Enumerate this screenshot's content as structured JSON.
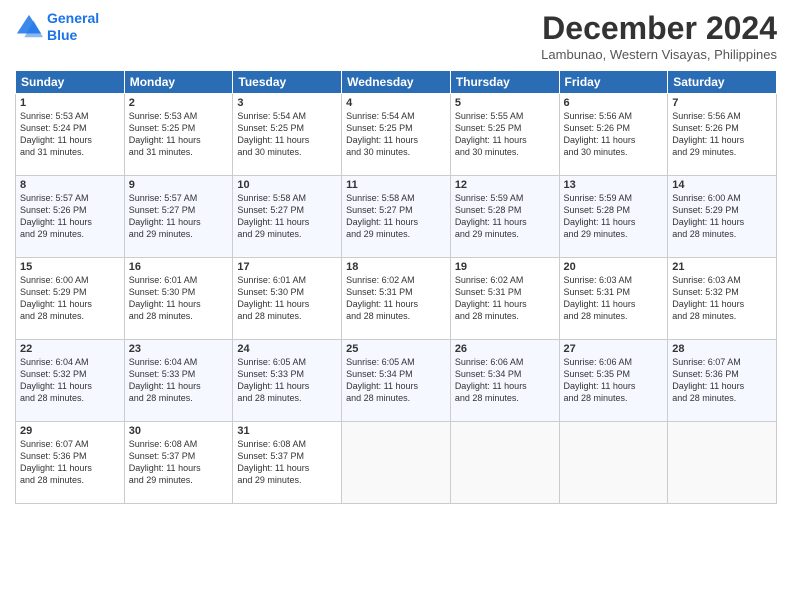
{
  "logo": {
    "line1": "General",
    "line2": "Blue"
  },
  "title": "December 2024",
  "location": "Lambunao, Western Visayas, Philippines",
  "days_header": [
    "Sunday",
    "Monday",
    "Tuesday",
    "Wednesday",
    "Thursday",
    "Friday",
    "Saturday"
  ],
  "weeks": [
    [
      {
        "day": "1",
        "info": "Sunrise: 5:53 AM\nSunset: 5:24 PM\nDaylight: 11 hours\nand 31 minutes."
      },
      {
        "day": "2",
        "info": "Sunrise: 5:53 AM\nSunset: 5:25 PM\nDaylight: 11 hours\nand 31 minutes."
      },
      {
        "day": "3",
        "info": "Sunrise: 5:54 AM\nSunset: 5:25 PM\nDaylight: 11 hours\nand 30 minutes."
      },
      {
        "day": "4",
        "info": "Sunrise: 5:54 AM\nSunset: 5:25 PM\nDaylight: 11 hours\nand 30 minutes."
      },
      {
        "day": "5",
        "info": "Sunrise: 5:55 AM\nSunset: 5:25 PM\nDaylight: 11 hours\nand 30 minutes."
      },
      {
        "day": "6",
        "info": "Sunrise: 5:56 AM\nSunset: 5:26 PM\nDaylight: 11 hours\nand 30 minutes."
      },
      {
        "day": "7",
        "info": "Sunrise: 5:56 AM\nSunset: 5:26 PM\nDaylight: 11 hours\nand 29 minutes."
      }
    ],
    [
      {
        "day": "8",
        "info": "Sunrise: 5:57 AM\nSunset: 5:26 PM\nDaylight: 11 hours\nand 29 minutes."
      },
      {
        "day": "9",
        "info": "Sunrise: 5:57 AM\nSunset: 5:27 PM\nDaylight: 11 hours\nand 29 minutes."
      },
      {
        "day": "10",
        "info": "Sunrise: 5:58 AM\nSunset: 5:27 PM\nDaylight: 11 hours\nand 29 minutes."
      },
      {
        "day": "11",
        "info": "Sunrise: 5:58 AM\nSunset: 5:27 PM\nDaylight: 11 hours\nand 29 minutes."
      },
      {
        "day": "12",
        "info": "Sunrise: 5:59 AM\nSunset: 5:28 PM\nDaylight: 11 hours\nand 29 minutes."
      },
      {
        "day": "13",
        "info": "Sunrise: 5:59 AM\nSunset: 5:28 PM\nDaylight: 11 hours\nand 29 minutes."
      },
      {
        "day": "14",
        "info": "Sunrise: 6:00 AM\nSunset: 5:29 PM\nDaylight: 11 hours\nand 28 minutes."
      }
    ],
    [
      {
        "day": "15",
        "info": "Sunrise: 6:00 AM\nSunset: 5:29 PM\nDaylight: 11 hours\nand 28 minutes."
      },
      {
        "day": "16",
        "info": "Sunrise: 6:01 AM\nSunset: 5:30 PM\nDaylight: 11 hours\nand 28 minutes."
      },
      {
        "day": "17",
        "info": "Sunrise: 6:01 AM\nSunset: 5:30 PM\nDaylight: 11 hours\nand 28 minutes."
      },
      {
        "day": "18",
        "info": "Sunrise: 6:02 AM\nSunset: 5:31 PM\nDaylight: 11 hours\nand 28 minutes."
      },
      {
        "day": "19",
        "info": "Sunrise: 6:02 AM\nSunset: 5:31 PM\nDaylight: 11 hours\nand 28 minutes."
      },
      {
        "day": "20",
        "info": "Sunrise: 6:03 AM\nSunset: 5:31 PM\nDaylight: 11 hours\nand 28 minutes."
      },
      {
        "day": "21",
        "info": "Sunrise: 6:03 AM\nSunset: 5:32 PM\nDaylight: 11 hours\nand 28 minutes."
      }
    ],
    [
      {
        "day": "22",
        "info": "Sunrise: 6:04 AM\nSunset: 5:32 PM\nDaylight: 11 hours\nand 28 minutes."
      },
      {
        "day": "23",
        "info": "Sunrise: 6:04 AM\nSunset: 5:33 PM\nDaylight: 11 hours\nand 28 minutes."
      },
      {
        "day": "24",
        "info": "Sunrise: 6:05 AM\nSunset: 5:33 PM\nDaylight: 11 hours\nand 28 minutes."
      },
      {
        "day": "25",
        "info": "Sunrise: 6:05 AM\nSunset: 5:34 PM\nDaylight: 11 hours\nand 28 minutes."
      },
      {
        "day": "26",
        "info": "Sunrise: 6:06 AM\nSunset: 5:34 PM\nDaylight: 11 hours\nand 28 minutes."
      },
      {
        "day": "27",
        "info": "Sunrise: 6:06 AM\nSunset: 5:35 PM\nDaylight: 11 hours\nand 28 minutes."
      },
      {
        "day": "28",
        "info": "Sunrise: 6:07 AM\nSunset: 5:36 PM\nDaylight: 11 hours\nand 28 minutes."
      }
    ],
    [
      {
        "day": "29",
        "info": "Sunrise: 6:07 AM\nSunset: 5:36 PM\nDaylight: 11 hours\nand 28 minutes."
      },
      {
        "day": "30",
        "info": "Sunrise: 6:08 AM\nSunset: 5:37 PM\nDaylight: 11 hours\nand 29 minutes."
      },
      {
        "day": "31",
        "info": "Sunrise: 6:08 AM\nSunset: 5:37 PM\nDaylight: 11 hours\nand 29 minutes."
      },
      {
        "day": "",
        "info": ""
      },
      {
        "day": "",
        "info": ""
      },
      {
        "day": "",
        "info": ""
      },
      {
        "day": "",
        "info": ""
      }
    ]
  ]
}
